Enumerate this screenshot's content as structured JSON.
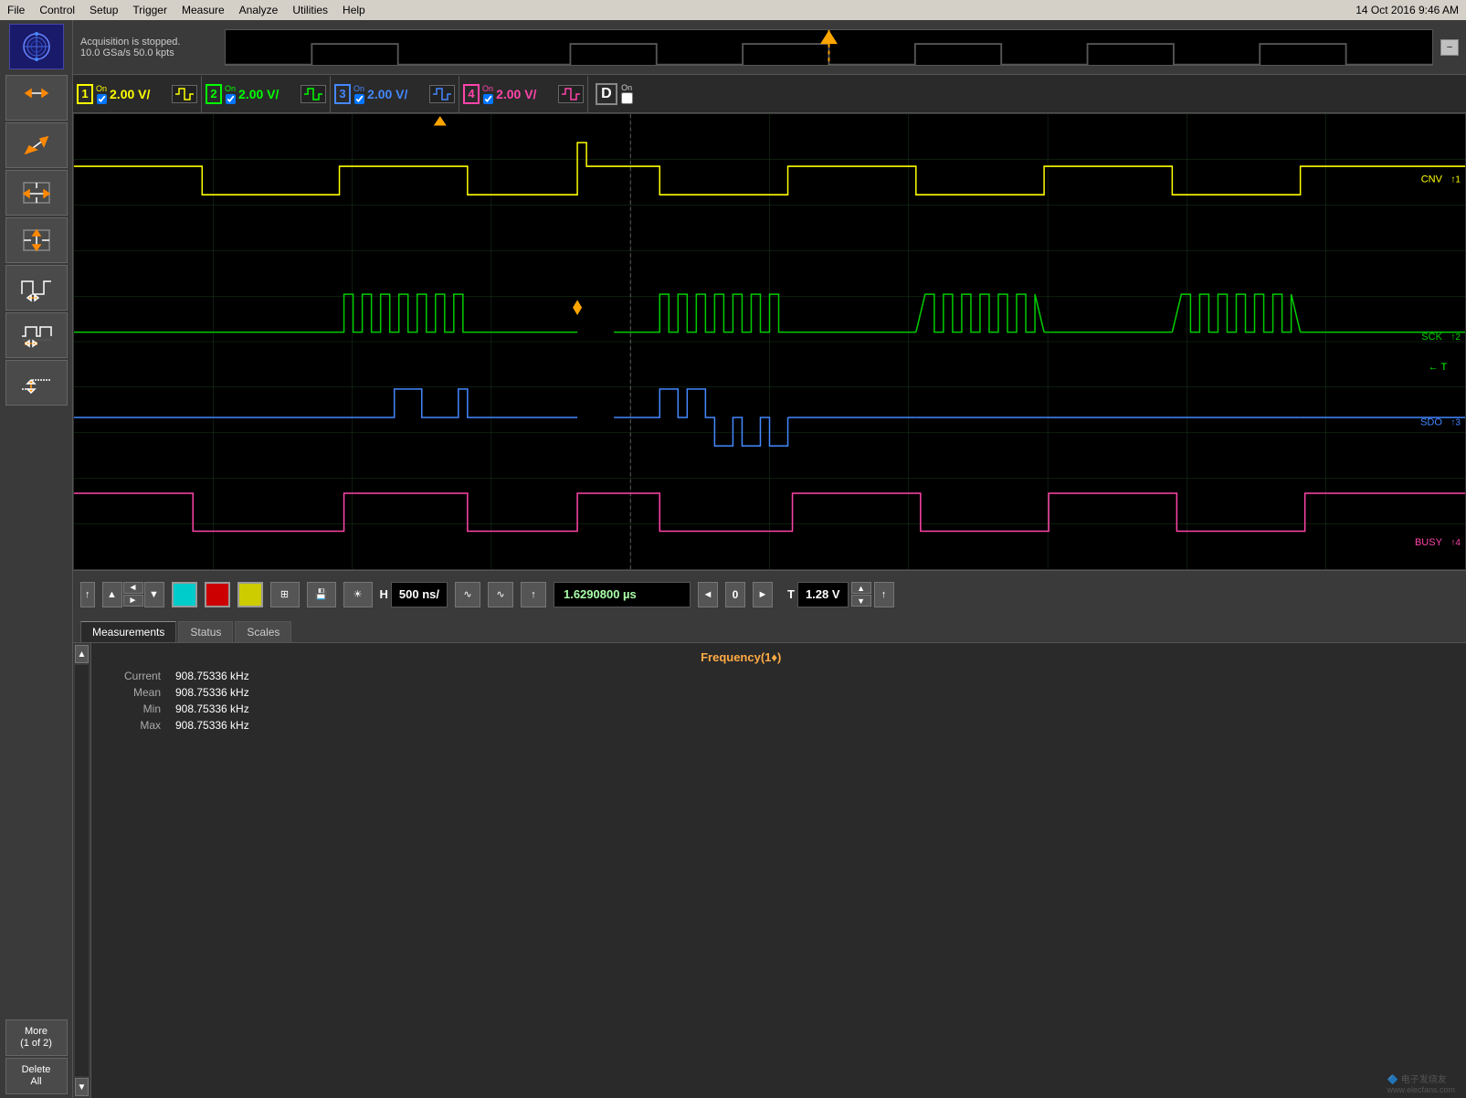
{
  "menubar": {
    "items": [
      "File",
      "Control",
      "Setup",
      "Trigger",
      "Measure",
      "Analyze",
      "Utilities",
      "Help"
    ],
    "datetime": "14 Oct 2016  9:46 AM"
  },
  "status": {
    "line1": "Acquisition is stopped.",
    "line2": "10.0 GSa/s    50.0 kpts"
  },
  "channels": [
    {
      "num": "1",
      "on": "On",
      "voltage": "2.00 V/",
      "checked": true,
      "color": "ch1"
    },
    {
      "num": "2",
      "on": "On",
      "voltage": "2.00 V/",
      "checked": true,
      "color": "ch2"
    },
    {
      "num": "3",
      "on": "On",
      "voltage": "2.00 V/",
      "checked": true,
      "color": "ch3"
    },
    {
      "num": "4",
      "on": "On",
      "voltage": "2.00 V/",
      "checked": true,
      "color": "ch4"
    },
    {
      "num": "D",
      "on": "On",
      "checked": false
    }
  ],
  "channel_labels": {
    "ch1": "CNV",
    "ch1_marker": "↑1",
    "ch2": "SCK",
    "ch2_marker": "↑2",
    "ch3": "SDO",
    "ch3_marker": "↑3",
    "ch4": "BUSY",
    "ch4_marker": "↑4",
    "t_arrow": "← T"
  },
  "control_bar": {
    "h_label": "H",
    "h_value": "500 ns/",
    "time_value": "1.6290800 µs",
    "t_label": "T",
    "t_value": "1.28 V"
  },
  "measurement_tabs": [
    "Measurements",
    "Status",
    "Scales"
  ],
  "active_tab": "Measurements",
  "measurements": {
    "title": "Frequency(1♦)",
    "rows": [
      {
        "label": "Current",
        "value": "908.75336 kHz"
      },
      {
        "label": "Mean",
        "value": "908.75336 kHz"
      },
      {
        "label": "Min",
        "value": "908.75336 kHz"
      },
      {
        "label": "Max",
        "value": "908.75336 kHz"
      }
    ]
  },
  "sidebar_tools": [
    {
      "name": "arrow-tool",
      "icon": "arrow"
    },
    {
      "name": "diagonal-tool",
      "icon": "diagonal"
    },
    {
      "name": "horizontal-measure-tool",
      "icon": "h-measure"
    },
    {
      "name": "vertical-measure-tool",
      "icon": "v-measure"
    },
    {
      "name": "pulse-measure-tool",
      "icon": "pulse"
    },
    {
      "name": "waveform-tool",
      "icon": "wave"
    },
    {
      "name": "step-tool",
      "icon": "step"
    }
  ],
  "more_label": "More\n(1 of 2)",
  "delete_all_label": "Delete\nAll",
  "buttons": {
    "up": "▲",
    "down": "▼",
    "left": "◄",
    "right": "►",
    "zero": "0",
    "minimize": "–"
  }
}
